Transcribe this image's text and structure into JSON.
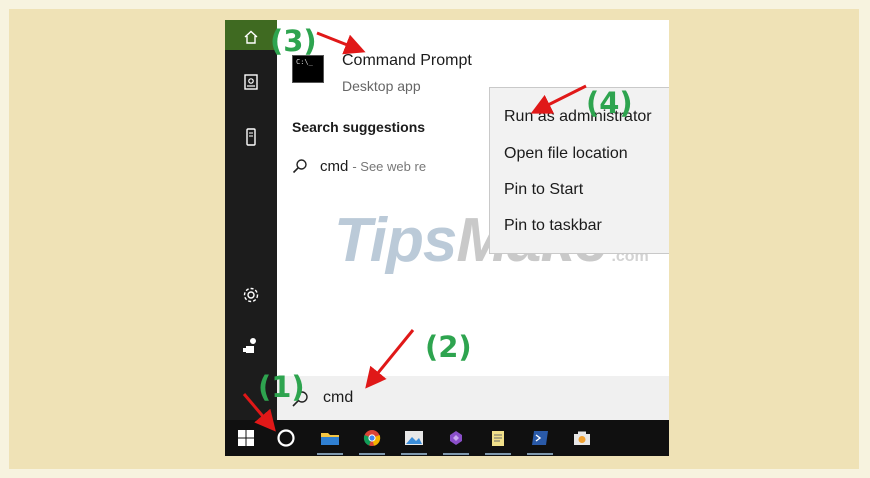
{
  "best_match": {
    "app_name": "Command Prompt",
    "app_type": "Desktop app",
    "app_icon_text": "C:\\_"
  },
  "suggestions": {
    "title": "Search suggestions",
    "items": [
      {
        "term": "cmd",
        "rest": "- See web re"
      }
    ]
  },
  "context_menu": {
    "items": [
      {
        "label": "Run as administrator"
      },
      {
        "label": "Open file location"
      },
      {
        "label": "Pin to Start"
      },
      {
        "label": "Pin to taskbar"
      }
    ]
  },
  "search": {
    "value": "cmd"
  },
  "step_labels": {
    "s1": "(1)",
    "s2": "(2)",
    "s3": "(3)",
    "s4": "(4)"
  },
  "watermark": {
    "tips": "Tips",
    "make": "Make",
    "dot_com": ".com"
  },
  "icons": {
    "rail": [
      "home-icon",
      "document-icon",
      "phone-icon",
      "gear-icon",
      "user-icon"
    ],
    "taskbar": [
      "windows-start-icon",
      "cortana-icon",
      "file-explorer-icon",
      "chrome-icon",
      "photos-icon",
      "visual-studio-icon",
      "notepad-icon",
      "powershell-icon",
      "camera-icon"
    ]
  },
  "colors": {
    "annotation_label": "#2ea44f",
    "annotation_arrow": "#e01818",
    "rail_active": "#3f6a21",
    "taskbar": "#101010",
    "background": "#efe2b6"
  }
}
